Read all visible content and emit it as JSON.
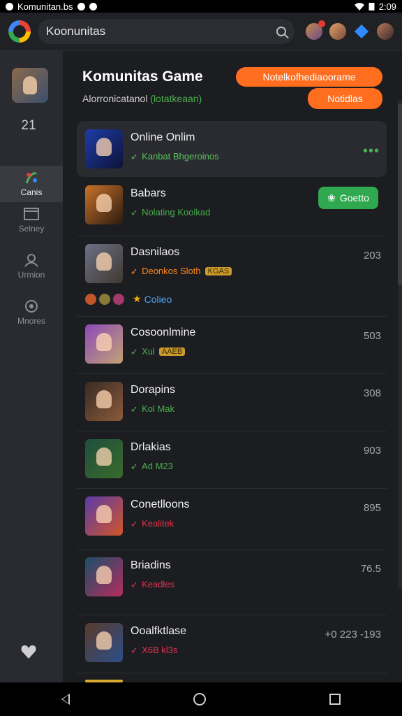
{
  "status_bar": {
    "app_name": "Komunitan.bs",
    "time": "2:09"
  },
  "top_bar": {
    "search_text": "Koonunitas"
  },
  "sidebar": {
    "number": "21",
    "items": [
      {
        "label": "Canis"
      },
      {
        "label": "Selney"
      },
      {
        "label": "Urmion"
      },
      {
        "label": "Mnores"
      }
    ]
  },
  "header": {
    "title": "Komunitas Game",
    "subtitle": "Alorronicatanol",
    "subtitle_tag": "(lotatkeaan)",
    "btn_notify": "Notelkofhediaoorame",
    "btn_notif": "Notidlas"
  },
  "games": [
    {
      "title": "Online Onlim",
      "sub": "Kanbat Bhgeroinos",
      "value": "",
      "sub_color": "#56c25a",
      "colors": [
        "#1d3da7",
        "#0e1238"
      ]
    },
    {
      "title": "Babars",
      "sub": "Nolating Koolkad",
      "value": "",
      "button": "Goetto",
      "sub_color": "#45b04a",
      "colors": [
        "#c8722a",
        "#2b1a10"
      ]
    },
    {
      "title": "Dasnilaos",
      "sub": "Deonkos Sloth",
      "tag": "KGAS",
      "value": "203",
      "sub_color": "#ff8a1c",
      "extra_label": "Colieo",
      "colors": [
        "#6d6f86",
        "#3f3a31"
      ]
    },
    {
      "title": "Cosoonlmine",
      "sub": "Xul",
      "tag": "AAEB",
      "value": "503",
      "sub_color": "#4caf50",
      "colors": [
        "#8b4ab8",
        "#c2a173"
      ]
    },
    {
      "title": "Dorapins",
      "sub": "Kol Mak",
      "value": "308",
      "sub_color": "#4caf50",
      "colors": [
        "#372b24",
        "#8b5a3b"
      ]
    },
    {
      "title": "Drlakias",
      "sub": "Ad M23",
      "value": "903",
      "sub_color": "#4caf50",
      "colors": [
        "#1f4f3f",
        "#3a6a2a"
      ]
    },
    {
      "title": "Conetlloons",
      "sub": "Kealitek",
      "value": "895",
      "sub_color": "#e0334e",
      "colors": [
        "#5a3aa8",
        "#d25628"
      ]
    },
    {
      "title": "Briadins",
      "sub": "Keadles",
      "value": "76.5",
      "sub_color": "#e0334e",
      "colors": [
        "#1b4f6a",
        "#b42d5e"
      ]
    },
    {
      "title": "Ooalfktlase",
      "sub": "X6B kl3s",
      "value": "+0 223 -193",
      "sub_color": "#e0334e",
      "colors": [
        "#5a3a2a",
        "#2a4f8a"
      ]
    }
  ]
}
